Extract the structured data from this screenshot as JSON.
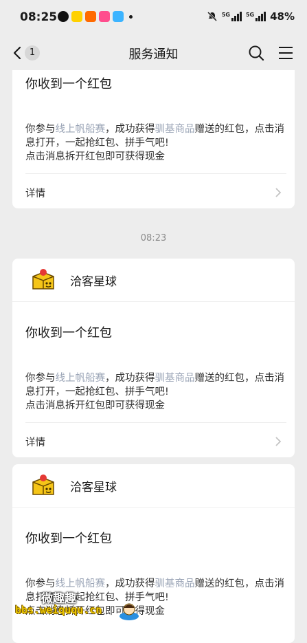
{
  "status_bar": {
    "time": "08:25",
    "battery": "48%",
    "network_a": "5G",
    "network_b": "5G"
  },
  "nav": {
    "back_badge": "1",
    "title": "服务通知"
  },
  "cards": [
    {
      "title": "你收到一个红包",
      "body_prefix": "你参与",
      "body_link1": "线上帆船赛",
      "body_mid": "，成功获得",
      "body_link2": "驯基商品",
      "body_suffix": "赠送的红包，点击消息打开，一起抢红包、拼手气吧!",
      "body_line2": "点击消息拆开红包即可获得现金",
      "detail": "详情"
    },
    {
      "sender": "洽客星球",
      "title": "你收到一个红包",
      "body_prefix": "你参与",
      "body_link1": "线上帆船赛",
      "body_mid": "，成功获得",
      "body_link2": "驯基商品",
      "body_suffix": "赠送的红包，点击消息打开，一起抢红包、拼手气吧!",
      "body_line2": "点击消息拆开红包即可获得现金",
      "detail": "详情"
    },
    {
      "sender": "洽客星球",
      "title": "你收到一个红包",
      "body_prefix": "你参与",
      "body_link1": "线上帆船赛",
      "body_mid": "，成功获得",
      "body_link2": "驯基商品",
      "body_suffix": "赠送的红包，点击消息打开，一起抢红包、拼手气吧!",
      "body_line2": "点击消息拆开红包即可获得现金"
    }
  ],
  "timestamp": "08:23",
  "watermark": {
    "cn": "微趣趣",
    "url": "bbs.weiququ.cn"
  },
  "colors": {
    "background": "#ededed",
    "link_text": "#9aa4b6"
  }
}
